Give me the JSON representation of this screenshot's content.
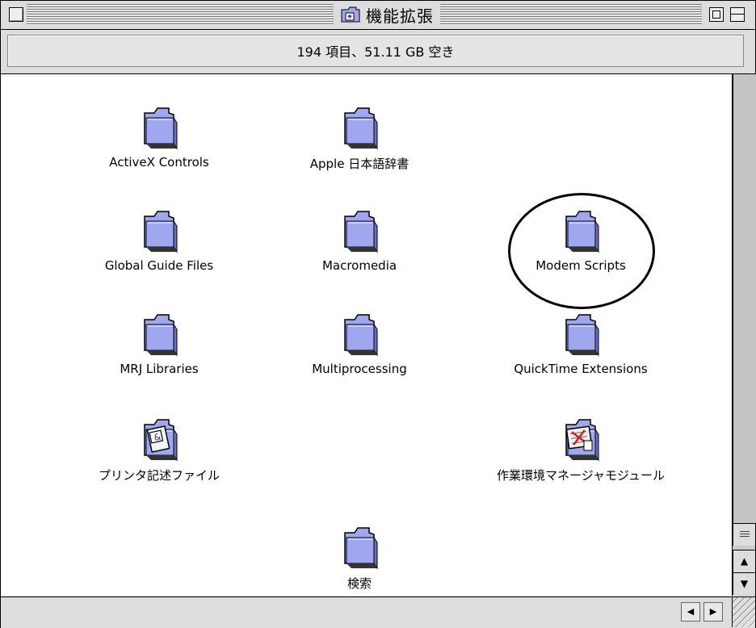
{
  "window": {
    "title": "機能拡張",
    "status": "194 項目、51.11 GB 空き"
  },
  "items": [
    {
      "label": "ActiveX Controls",
      "icon": "folder-icon"
    },
    {
      "label": "Apple 日本語辞書",
      "icon": "folder-icon"
    },
    {
      "label": "Global Guide Files",
      "icon": "folder-icon"
    },
    {
      "label": "Macromedia",
      "icon": "folder-icon"
    },
    {
      "label": "Modem Scripts",
      "icon": "folder-icon",
      "highlighted": true
    },
    {
      "label": "MRJ Libraries",
      "icon": "folder-icon"
    },
    {
      "label": "Multiprocessing",
      "icon": "folder-icon"
    },
    {
      "label": "QuickTime Extensions",
      "icon": "folder-icon"
    },
    {
      "label": "プリンタ記述ファイル",
      "icon": "printer-description-folder-icon"
    },
    {
      "label": "作業環境マネージャモジュール",
      "icon": "environment-manager-folder-icon"
    },
    {
      "label": "検索",
      "icon": "folder-icon"
    }
  ],
  "scrollbar": {
    "up_arrow": "▲",
    "down_arrow": "▼",
    "left_arrow": "◀",
    "right_arrow": "▶"
  },
  "colors": {
    "folder": "#9fa7ee",
    "folder_dark": "#6a6fc0",
    "chrome": "#dddddd"
  }
}
